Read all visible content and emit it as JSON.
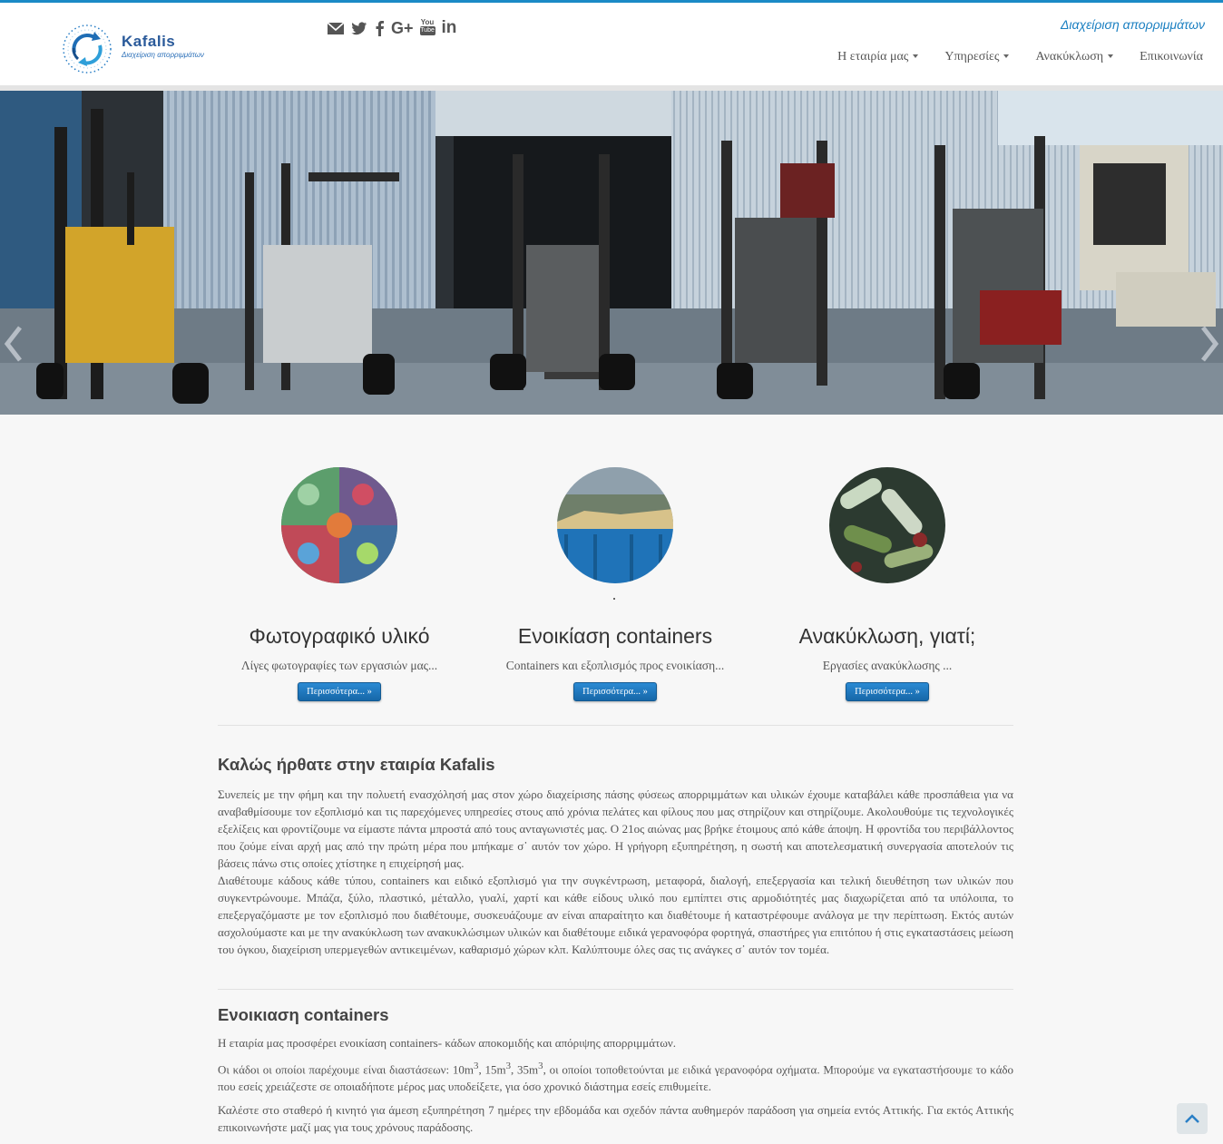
{
  "header": {
    "logo": {
      "name": "Kafalis",
      "tagline": "Διαχείριση απορριμμάτων"
    },
    "site_tagline": "Διαχείριση απορριμμάτων",
    "social_icons": [
      "envelope-icon",
      "twitter-icon",
      "facebook-icon",
      "google-plus-icon",
      "youtube-icon",
      "linkedin-icon"
    ],
    "social_labels": {
      "google_plus": "G+",
      "youtube_top": "You",
      "youtube_bottom": "Tube",
      "linkedin": "in"
    },
    "nav": [
      {
        "label": "Η εταιρία μας",
        "dropdown": true
      },
      {
        "label": "Υπηρεσίες",
        "dropdown": true
      },
      {
        "label": "Ανακύκλωση",
        "dropdown": true
      },
      {
        "label": "Επικοινωνία",
        "dropdown": false
      }
    ]
  },
  "slider": {
    "prev_icon": "chevron-left-icon",
    "next_icon": "chevron-right-icon"
  },
  "features": [
    {
      "title": "Φωτογραφικό υλικό",
      "text": "Λίγες φωτογραφίες των εργασιών μας...",
      "button": "Περισσότερα... »"
    },
    {
      "title": "Ενοικίαση containers",
      "text": "Containers και εξοπλισμός προς ενοικίαση...",
      "button": "Περισσότερα... »"
    },
    {
      "title": "Ανακύκλωση, γιατί;",
      "text": "Εργασίες ανακύκλωσης ...",
      "button": "Περισσότερα... »"
    }
  ],
  "welcome": {
    "heading": "Καλώς ήρθατε στην εταιρία Kafalis",
    "p1": "Συνεπείς με την φήμη και την πολυετή ενασχόλησή μας στον χώρο διαχείρισης πάσης φύσεως απορριμμάτων και υλικών έχουμε καταβάλει κάθε προσπάθεια για να αναβαθμίσουμε τον εξοπλισμό και τις παρεχόμενες υπηρεσίες στους από χρόνια πελάτες και φίλους που μας στηρίζουν και στηρίζουμε. Ακολουθούμε τις τεχνολογικές εξελίξεις και φροντίζουμε να είμαστε πάντα μπροστά από τους ανταγωνιστές μας. Ο 21ος αιώνας μας βρήκε έτοιμους από κάθε άποψη. Η φροντίδα του περιβάλλοντος που ζούμε είναι αρχή μας από την πρώτη μέρα που μπήκαμε σ᾽ αυτόν τον χώρο. Η γρήγορη εξυπηρέτηση, η σωστή και αποτελεσματική συνεργασία αποτελούν τις βάσεις πάνω στις οποίες χτίστηκε η επιχείρησή μας.",
    "p2": "Διαθέτουμε κάδους κάθε τύπου, containers και ειδικό εξοπλισμό για την συγκέντρωση, μεταφορά, διαλογή, επεξεργασία και τελική διευθέτηση των υλικών που συγκεντρώνουμε. Μπάζα, ξύλο, πλαστικό, μέταλλο, γυαλί, χαρτί και κάθε είδους υλικό που εμπίπτει στις αρμοδιότητές μας διαχωρίζεται από τα υπόλοιπα, το επεξεργαζόμαστε με τον εξοπλισμό που διαθέτουμε, συσκευάζουμε αν είναι απαραίτητο και διαθέτουμε ή καταστρέφουμε ανάλογα με την περίπτωση. Εκτός αυτών ασχολούμαστε και με την ανακύκλωση των ανακυκλώσιμων υλικών και διαθέτουμε ειδικά γερανοφόρα φορτηγά, σπαστήρες για επιτόπου ή στις εγκαταστάσεις μείωση του όγκου, διαχείριση υπερμεγεθών αντικειμένων, καθαρισμό χώρων κλπ. Καλύπτουμε όλες σας τις ανάγκες σ᾽ αυτόν τον τομέα."
  },
  "rental": {
    "heading": "Ενοικιαση containers",
    "p1": "Η εταιρία μας προσφέρει ενοικίαση containers- κάδων αποκομιδής και απόριψης απορριμμάτων.",
    "p2_pre": "Οι κάδοι οι οποίοι παρέχουμε είναι διαστάσεων: ",
    "sizes": [
      "10m",
      "15m",
      "35m"
    ],
    "sup": "3",
    "p2_post": ", οι οποίοι τοποθετούνται με ειδικά γερανοφόρα οχήματα. Μπορούμε να εγκαταστήσουμε το κάδο που εσείς χρειάζεστε σε οποιαδήποτε μέρος μας υποδείξετε, για όσο χρονικό διάστημα εσείς επιθυμείτε.",
    "p3": "Καλέστε στο σταθερό ή κινητό για άμεση εξυπηρέτηση 7 ημέρες την εβδομάδα και σχεδόν πάντα αυθημερόν παράδοση για σημεία εντός Αττικής. Για εκτός Αττικής επικοινωνήστε μαζί μας για τους χρόνους παράδοσης."
  },
  "back_to_top_icon": "chevron-up-icon"
}
